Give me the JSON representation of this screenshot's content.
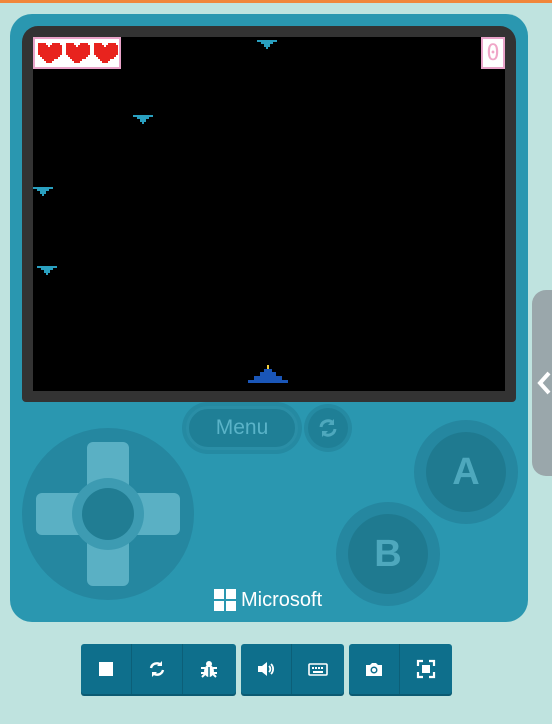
{
  "game": {
    "lives": 3,
    "score": "0",
    "enemies": [
      {
        "name": "enemy-ship-1"
      },
      {
        "name": "enemy-ship-2"
      },
      {
        "name": "enemy-ship-3"
      },
      {
        "name": "enemy-ship-4"
      }
    ]
  },
  "controls": {
    "menu_label": "Menu",
    "a_label": "A",
    "b_label": "B",
    "brand": "Microsoft"
  },
  "toolbar": {
    "groups": [
      [
        "stop-icon",
        "restart-icon",
        "debug-icon"
      ],
      [
        "sound-icon",
        "keyboard-icon"
      ],
      [
        "screenshot-icon",
        "fullscreen-icon"
      ]
    ]
  },
  "colors": {
    "console": "#2a97b0",
    "heart": "#e8231e",
    "enemy": "#2aa0c0",
    "player": "#1a56b8",
    "toolbar": "#0e6f8c"
  }
}
